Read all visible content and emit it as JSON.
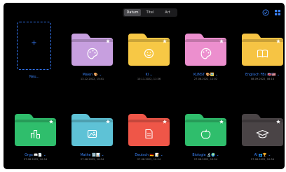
{
  "segmented": {
    "items": [
      "Datum",
      "Titel",
      "Art"
    ],
    "selected": 0
  },
  "toolbar": {
    "check_icon": "checkmark-circle-icon",
    "grid_icon": "grid-icon"
  },
  "new_item": {
    "label": "Neu..."
  },
  "folders": [
    {
      "name": "Malen 🎨 ⌄",
      "date": "13.12.2022, 15:41",
      "color": "#c79fdf",
      "icon": "palette-icon"
    },
    {
      "name": "KI ⌄",
      "date": "10.11.2022, 11:36",
      "color": "#f7c845",
      "icon": "smiley-icon"
    },
    {
      "name": "KUNST 🎨🖼️ ⌄",
      "date": "27.08.2022, 11:02",
      "color": "#ec8fce",
      "icon": "palette-icon"
    },
    {
      "name": "Englisch FBs 🇬🇧🇺🇸 ⌄",
      "date": "08.09.2022, 08:14",
      "color": "#f6c444",
      "icon": "book-icon"
    },
    {
      "name": "Orga 📖📄 ⌄",
      "date": "27.08.2022, 10:54",
      "color": "#2fbe6c",
      "icon": "chart-icon"
    },
    {
      "name": "Mathe 🔢📊 ⌄",
      "date": "27.08.2022, 10:54",
      "color": "#5ec2d6",
      "icon": "image-icon"
    },
    {
      "name": "Deutsch 🇩🇪 📝 ⌄",
      "date": "27.08.2022, 10:54",
      "color": "#ef5648",
      "icon": "document-icon"
    },
    {
      "name": "Biologie 🔬🌍 ⌄",
      "date": "27.08.2022, 10:54",
      "color": "#2fbe6c",
      "icon": "apple-icon"
    },
    {
      "name": "AI 👥🏆 ⌄",
      "date": "27.08.2022, 10:54",
      "color": "#4a4446",
      "icon": "graduation-cap-icon"
    }
  ]
}
